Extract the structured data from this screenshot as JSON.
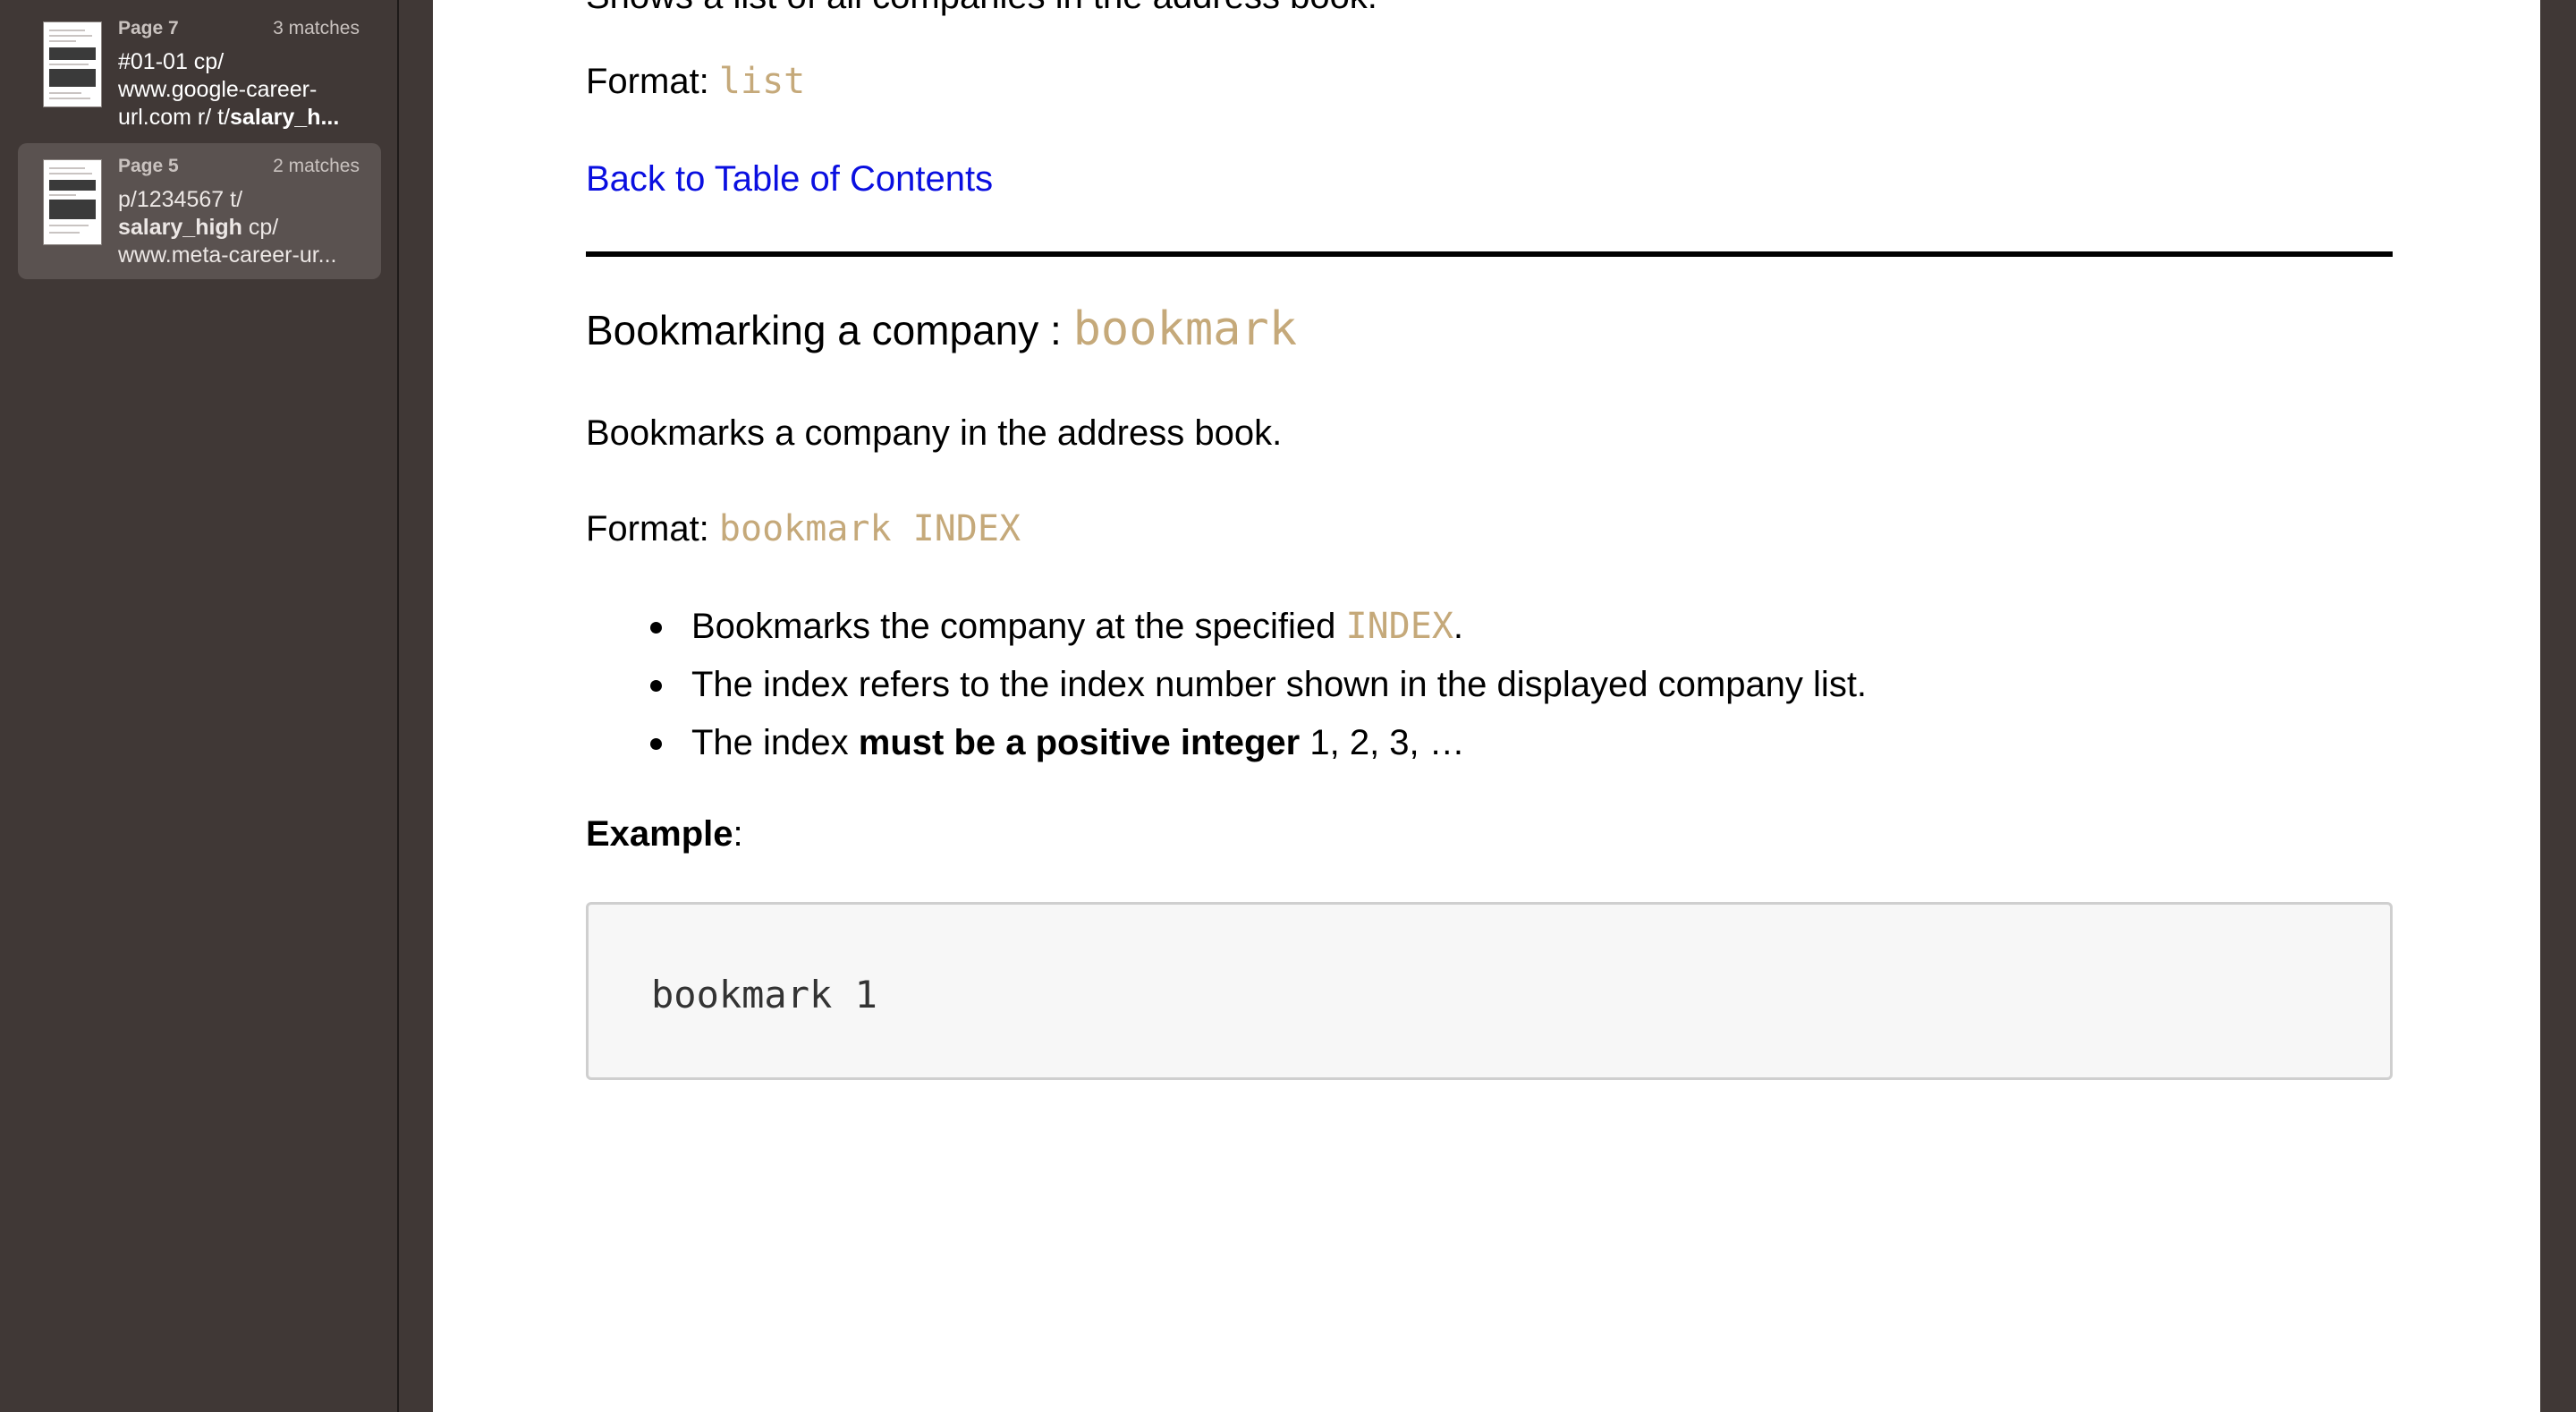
{
  "sidebar": {
    "results": [
      {
        "page": "Page 7",
        "count": "3 matches",
        "snippet": {
          "line1": "#01-01 cp/",
          "line2": "www.google-career-",
          "line3_pre": "url.com r/ t/",
          "line3_hl": "salary_h..."
        }
      },
      {
        "page": "Page 5",
        "count": "2 matches",
        "snippet": {
          "line1": "p/1234567 t/",
          "line2_hl": "salary_high",
          "line2_post": " cp/",
          "line3": "www.meta-career-ur..."
        }
      }
    ]
  },
  "doc": {
    "cut_line": "Shows a list of all companies in the address book.",
    "format1_label": "Format: ",
    "format1_code": "list",
    "back_link": "Back to Table of Contents",
    "heading_text": "Bookmarking a company : ",
    "heading_code": "bookmark",
    "description": "Bookmarks a company in the address book.",
    "format2_label": "Format: ",
    "format2_code": "bookmark INDEX",
    "bullet1_pre": "Bookmarks the company at the specified ",
    "bullet1_code": "INDEX",
    "bullet1_post": ".",
    "bullet2": "The index refers to the index number shown in the displayed company list.",
    "bullet3_pre": "The index ",
    "bullet3_bold": "must be a positive integer",
    "bullet3_post": " 1, 2, 3, …",
    "example_label": "Example",
    "example_colon": ":",
    "example_code": "bookmark 1"
  }
}
